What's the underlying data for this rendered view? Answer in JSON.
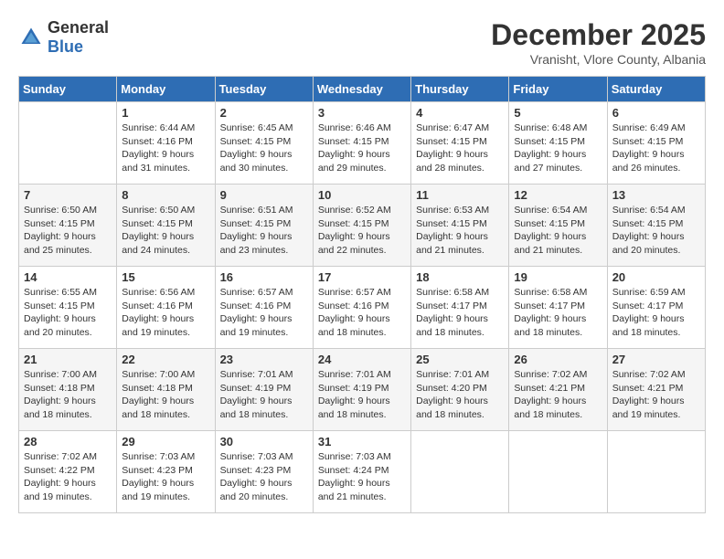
{
  "header": {
    "logo_general": "General",
    "logo_blue": "Blue",
    "month": "December 2025",
    "location": "Vranisht, Vlore County, Albania"
  },
  "weekdays": [
    "Sunday",
    "Monday",
    "Tuesday",
    "Wednesday",
    "Thursday",
    "Friday",
    "Saturday"
  ],
  "weeks": [
    [
      {
        "day": "",
        "sunrise": "",
        "sunset": "",
        "daylight": ""
      },
      {
        "day": "1",
        "sunrise": "Sunrise: 6:44 AM",
        "sunset": "Sunset: 4:16 PM",
        "daylight": "Daylight: 9 hours and 31 minutes."
      },
      {
        "day": "2",
        "sunrise": "Sunrise: 6:45 AM",
        "sunset": "Sunset: 4:15 PM",
        "daylight": "Daylight: 9 hours and 30 minutes."
      },
      {
        "day": "3",
        "sunrise": "Sunrise: 6:46 AM",
        "sunset": "Sunset: 4:15 PM",
        "daylight": "Daylight: 9 hours and 29 minutes."
      },
      {
        "day": "4",
        "sunrise": "Sunrise: 6:47 AM",
        "sunset": "Sunset: 4:15 PM",
        "daylight": "Daylight: 9 hours and 28 minutes."
      },
      {
        "day": "5",
        "sunrise": "Sunrise: 6:48 AM",
        "sunset": "Sunset: 4:15 PM",
        "daylight": "Daylight: 9 hours and 27 minutes."
      },
      {
        "day": "6",
        "sunrise": "Sunrise: 6:49 AM",
        "sunset": "Sunset: 4:15 PM",
        "daylight": "Daylight: 9 hours and 26 minutes."
      }
    ],
    [
      {
        "day": "7",
        "sunrise": "Sunrise: 6:50 AM",
        "sunset": "Sunset: 4:15 PM",
        "daylight": "Daylight: 9 hours and 25 minutes."
      },
      {
        "day": "8",
        "sunrise": "Sunrise: 6:50 AM",
        "sunset": "Sunset: 4:15 PM",
        "daylight": "Daylight: 9 hours and 24 minutes."
      },
      {
        "day": "9",
        "sunrise": "Sunrise: 6:51 AM",
        "sunset": "Sunset: 4:15 PM",
        "daylight": "Daylight: 9 hours and 23 minutes."
      },
      {
        "day": "10",
        "sunrise": "Sunrise: 6:52 AM",
        "sunset": "Sunset: 4:15 PM",
        "daylight": "Daylight: 9 hours and 22 minutes."
      },
      {
        "day": "11",
        "sunrise": "Sunrise: 6:53 AM",
        "sunset": "Sunset: 4:15 PM",
        "daylight": "Daylight: 9 hours and 21 minutes."
      },
      {
        "day": "12",
        "sunrise": "Sunrise: 6:54 AM",
        "sunset": "Sunset: 4:15 PM",
        "daylight": "Daylight: 9 hours and 21 minutes."
      },
      {
        "day": "13",
        "sunrise": "Sunrise: 6:54 AM",
        "sunset": "Sunset: 4:15 PM",
        "daylight": "Daylight: 9 hours and 20 minutes."
      }
    ],
    [
      {
        "day": "14",
        "sunrise": "Sunrise: 6:55 AM",
        "sunset": "Sunset: 4:15 PM",
        "daylight": "Daylight: 9 hours and 20 minutes."
      },
      {
        "day": "15",
        "sunrise": "Sunrise: 6:56 AM",
        "sunset": "Sunset: 4:16 PM",
        "daylight": "Daylight: 9 hours and 19 minutes."
      },
      {
        "day": "16",
        "sunrise": "Sunrise: 6:57 AM",
        "sunset": "Sunset: 4:16 PM",
        "daylight": "Daylight: 9 hours and 19 minutes."
      },
      {
        "day": "17",
        "sunrise": "Sunrise: 6:57 AM",
        "sunset": "Sunset: 4:16 PM",
        "daylight": "Daylight: 9 hours and 18 minutes."
      },
      {
        "day": "18",
        "sunrise": "Sunrise: 6:58 AM",
        "sunset": "Sunset: 4:17 PM",
        "daylight": "Daylight: 9 hours and 18 minutes."
      },
      {
        "day": "19",
        "sunrise": "Sunrise: 6:58 AM",
        "sunset": "Sunset: 4:17 PM",
        "daylight": "Daylight: 9 hours and 18 minutes."
      },
      {
        "day": "20",
        "sunrise": "Sunrise: 6:59 AM",
        "sunset": "Sunset: 4:17 PM",
        "daylight": "Daylight: 9 hours and 18 minutes."
      }
    ],
    [
      {
        "day": "21",
        "sunrise": "Sunrise: 7:00 AM",
        "sunset": "Sunset: 4:18 PM",
        "daylight": "Daylight: 9 hours and 18 minutes."
      },
      {
        "day": "22",
        "sunrise": "Sunrise: 7:00 AM",
        "sunset": "Sunset: 4:18 PM",
        "daylight": "Daylight: 9 hours and 18 minutes."
      },
      {
        "day": "23",
        "sunrise": "Sunrise: 7:01 AM",
        "sunset": "Sunset: 4:19 PM",
        "daylight": "Daylight: 9 hours and 18 minutes."
      },
      {
        "day": "24",
        "sunrise": "Sunrise: 7:01 AM",
        "sunset": "Sunset: 4:19 PM",
        "daylight": "Daylight: 9 hours and 18 minutes."
      },
      {
        "day": "25",
        "sunrise": "Sunrise: 7:01 AM",
        "sunset": "Sunset: 4:20 PM",
        "daylight": "Daylight: 9 hours and 18 minutes."
      },
      {
        "day": "26",
        "sunrise": "Sunrise: 7:02 AM",
        "sunset": "Sunset: 4:21 PM",
        "daylight": "Daylight: 9 hours and 18 minutes."
      },
      {
        "day": "27",
        "sunrise": "Sunrise: 7:02 AM",
        "sunset": "Sunset: 4:21 PM",
        "daylight": "Daylight: 9 hours and 19 minutes."
      }
    ],
    [
      {
        "day": "28",
        "sunrise": "Sunrise: 7:02 AM",
        "sunset": "Sunset: 4:22 PM",
        "daylight": "Daylight: 9 hours and 19 minutes."
      },
      {
        "day": "29",
        "sunrise": "Sunrise: 7:03 AM",
        "sunset": "Sunset: 4:23 PM",
        "daylight": "Daylight: 9 hours and 19 minutes."
      },
      {
        "day": "30",
        "sunrise": "Sunrise: 7:03 AM",
        "sunset": "Sunset: 4:23 PM",
        "daylight": "Daylight: 9 hours and 20 minutes."
      },
      {
        "day": "31",
        "sunrise": "Sunrise: 7:03 AM",
        "sunset": "Sunset: 4:24 PM",
        "daylight": "Daylight: 9 hours and 21 minutes."
      },
      {
        "day": "",
        "sunrise": "",
        "sunset": "",
        "daylight": ""
      },
      {
        "day": "",
        "sunrise": "",
        "sunset": "",
        "daylight": ""
      },
      {
        "day": "",
        "sunrise": "",
        "sunset": "",
        "daylight": ""
      }
    ]
  ]
}
